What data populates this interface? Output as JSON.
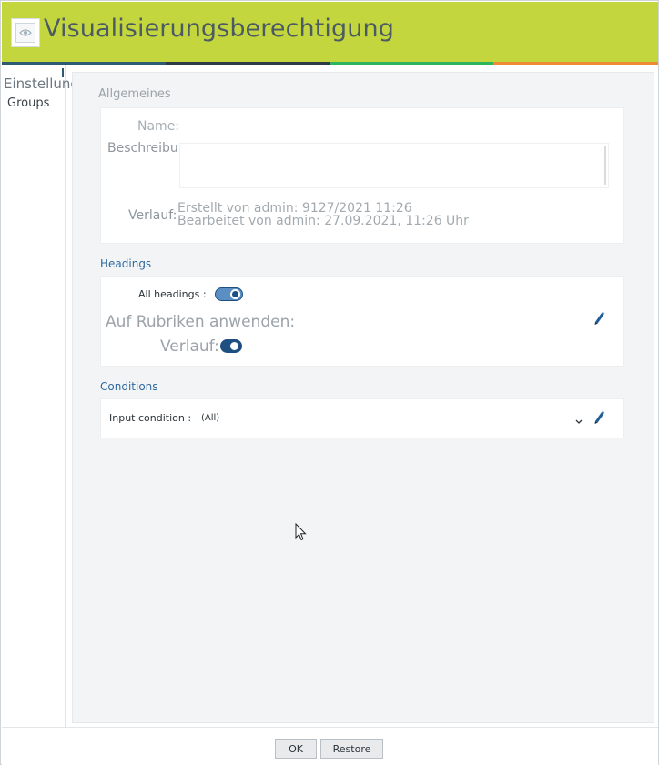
{
  "window": {
    "title": "Visualisierungsberechtigung",
    "title_icon": "eye-icon",
    "accent_color": "#c4d63e",
    "stripe_colors": [
      "#2b5a72",
      "#2d3b46",
      "#2fb45e",
      "#ee8a35"
    ]
  },
  "sidebar": {
    "heading": "Einstellungen",
    "items": [
      {
        "label": "Groups"
      }
    ]
  },
  "general": {
    "section_title": "Allgemeines",
    "name_label": "Name:",
    "name_value": "",
    "description_label": "Beschreibung:",
    "description_value": "",
    "history_label": "Verlauf:",
    "created_line": "Erstellt von admin: 9127/2021 11:26",
    "edited_line": "Bearbeitet von admin: 27.09.2021, 11:26 Uhr"
  },
  "headings": {
    "section_title": "Headings",
    "all_headings_label": "All headings :",
    "all_headings_on": true,
    "apply_label": "Auf Rubriken anwenden:",
    "history_label": "Verlauf:",
    "history_on": true,
    "edit_icon": "pencil-icon"
  },
  "conditions": {
    "section_title": "Conditions",
    "input_condition_label": "Input condition :",
    "input_condition_value": "(All)",
    "dropdown_icon": "chevron-down-icon",
    "edit_icon": "pencil-icon"
  },
  "footer": {
    "ok_label": "OK",
    "restore_label": "Restore"
  }
}
